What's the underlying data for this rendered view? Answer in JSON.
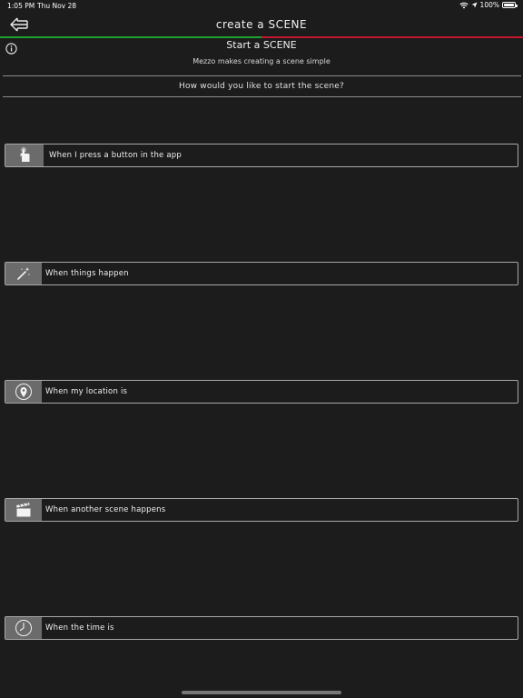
{
  "status_bar": {
    "time": "1:05 PM",
    "date": "Thu Nov 28",
    "battery": "100%"
  },
  "header": {
    "title": "create a SCENE",
    "back_icon": "back-arrow-icon"
  },
  "intro": {
    "subtitle": "Start a SCENE",
    "caption": "Mezzo makes creating a scene simple",
    "question": "How would you like to start the scene?"
  },
  "options": [
    {
      "label": "When I press a button in the app",
      "icon": "finger-tap-icon"
    },
    {
      "label": "When things happen",
      "icon": "magic-wand-icon"
    },
    {
      "label": "When my location is",
      "icon": "location-pin-icon"
    },
    {
      "label": "When another scene happens",
      "icon": "clapperboard-icon"
    },
    {
      "label": "When the time is",
      "icon": "clock-icon"
    }
  ]
}
